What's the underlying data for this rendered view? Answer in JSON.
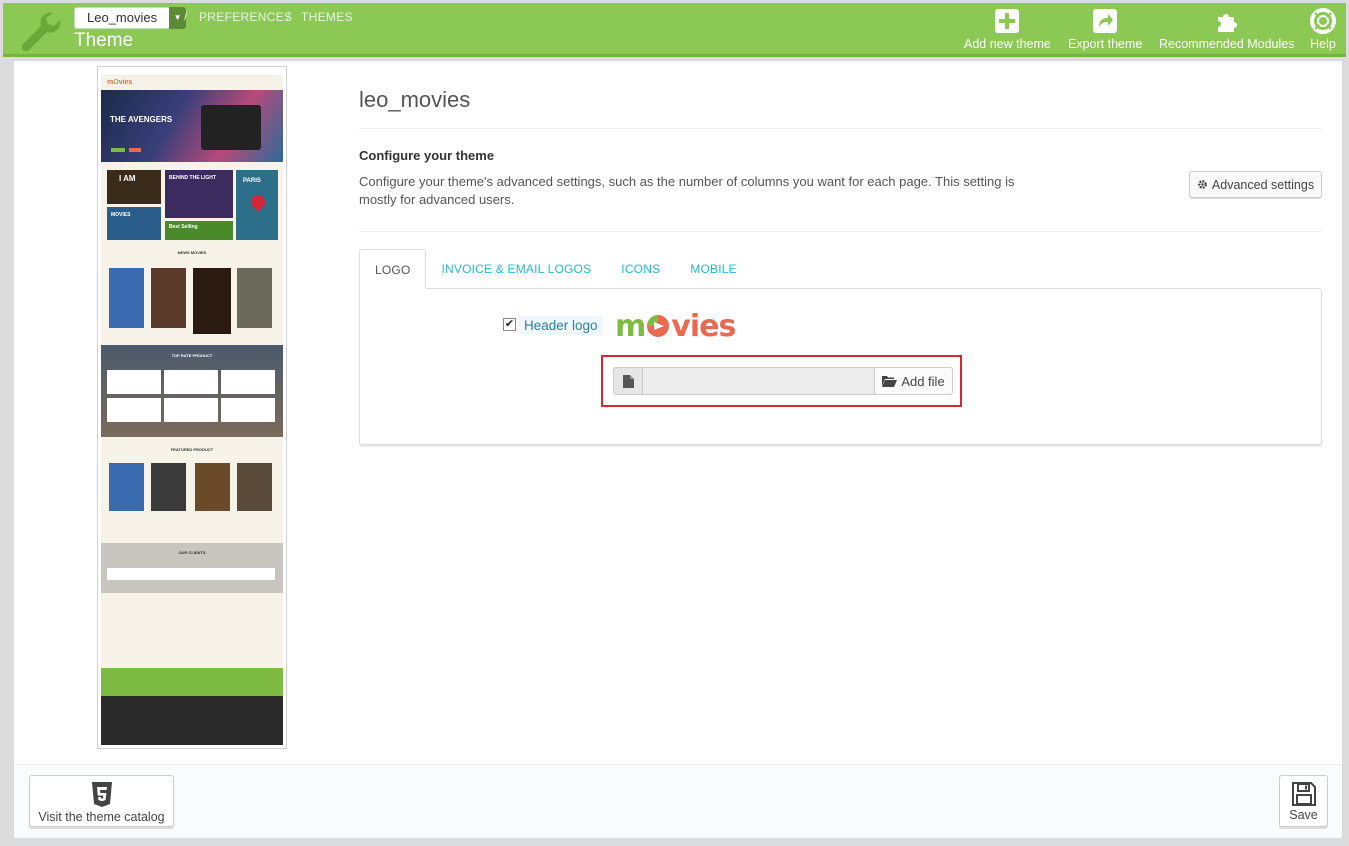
{
  "header": {
    "shop_select_value": "Leo_movies",
    "breadcrumb": [
      "PREFERENCES",
      "THEMES"
    ],
    "title": "Theme",
    "toolbar": [
      {
        "label": "Add new theme",
        "icon": "plus-square-icon"
      },
      {
        "label": "Export theme",
        "icon": "share-icon"
      },
      {
        "label": "Recommended Modules",
        "icon": "puzzle-icon"
      },
      {
        "label": "Help",
        "icon": "lifebuoy-icon"
      }
    ]
  },
  "main": {
    "theme_name": "leo_movies",
    "configure_title": "Configure your theme",
    "configure_desc": "Configure your theme's advanced settings, such as the number of columns you want for each page. This setting is mostly for advanced users.",
    "advanced_settings_label": "Advanced settings",
    "tabs": [
      {
        "label": "LOGO",
        "active": true
      },
      {
        "label": "INVOICE & EMAIL LOGOS",
        "active": false
      },
      {
        "label": "ICONS",
        "active": false
      },
      {
        "label": "MOBILE",
        "active": false
      }
    ],
    "header_logo_label": "Header logo",
    "header_logo_checked": true,
    "logo_text_m": "m",
    "logo_text_rest": "vies",
    "add_file_label": "Add file"
  },
  "preview": {
    "hero_title": "THE AVENGERS",
    "promo_1": "I AM",
    "promo_2": "BEHIND THE LIGHT",
    "promo_3": "PARIS",
    "promo_4": "MOVIES",
    "promo_5": "Best Selling",
    "section_1": "NEWS MOVIES",
    "section_2": "TOP RATE PRODUCT",
    "section_3": "FEATURED PRODUCT",
    "section_4": "OUR CLIENTS"
  },
  "footer": {
    "catalog_label": "Visit the theme catalog",
    "save_label": "Save"
  },
  "colors": {
    "header_green": "#8bc954",
    "link_blue": "#25b9d7",
    "highlight_red": "#d9252f",
    "logo_green": "#7dbb43",
    "logo_orange": "#e96a50"
  }
}
